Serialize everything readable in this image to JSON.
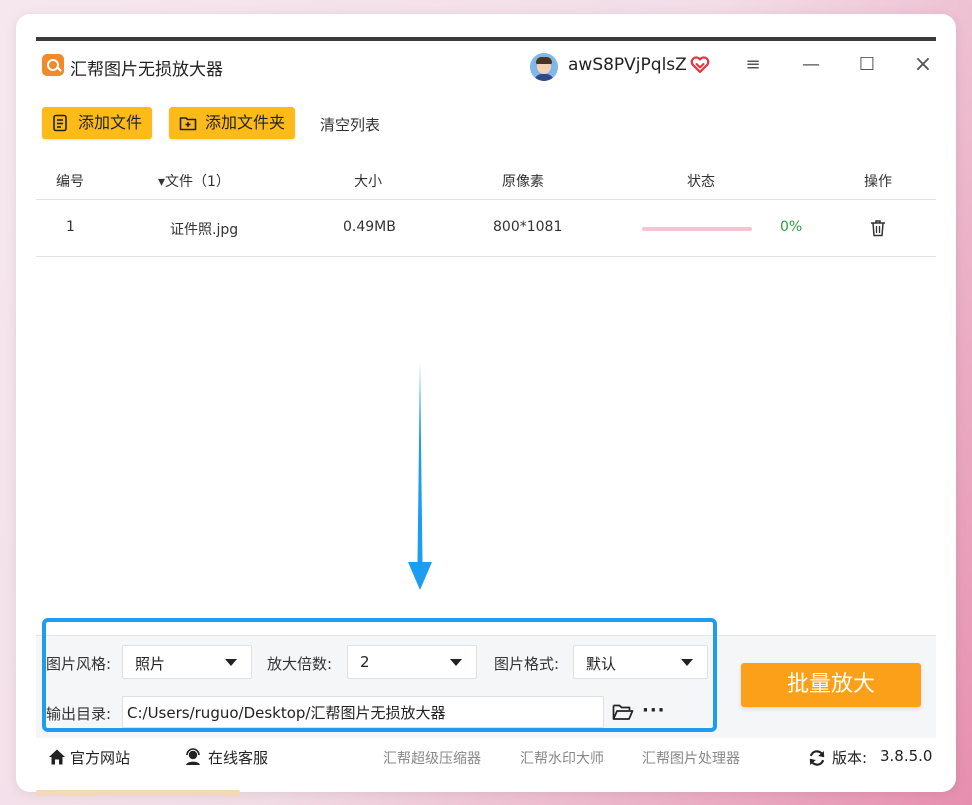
{
  "window": {
    "title": "汇帮图片无损放大器",
    "username": "awS8PVjPqlsZ",
    "controls": {
      "menu": "≡",
      "minimize": "—",
      "maximize": "☐",
      "close": "×"
    }
  },
  "toolbar": {
    "add_file": "添加文件",
    "add_folder": "添加文件夹",
    "clear_list": "清空列表"
  },
  "table": {
    "headers": {
      "index": "编号",
      "file": "▾文件（1）",
      "size": "大小",
      "pixels": "原像素",
      "status": "状态",
      "action": "操作"
    },
    "rows": [
      {
        "index": "1",
        "file": "证件照.jpg",
        "size": "0.49MB",
        "pixels": "800*1081",
        "progress": 0,
        "progress_text": "0%"
      }
    ]
  },
  "settings": {
    "style_label": "图片风格:",
    "style_value": "照片",
    "scale_label": "放大倍数:",
    "scale_value": "2",
    "format_label": "图片格式:",
    "format_value": "默认",
    "output_label": "输出目录:",
    "output_path": "C:/Users/ruguo/Desktop/汇帮图片无损放大器",
    "more": "···",
    "batch_button": "批量放大"
  },
  "footer": {
    "website": "官方网站",
    "support": "在线客服",
    "link1": "汇帮超级压缩器",
    "link2": "汇帮水印大师",
    "link3": "汇帮图片处理器",
    "version_label": "版本:",
    "version": "3.8.5.0"
  },
  "colors": {
    "accent_yellow": "#fdbb19",
    "batch_orange": "#fca01a",
    "highlight_blue": "#1e9df0",
    "progress_pink": "#f5c4d2",
    "status_green": "#2e9e3e"
  },
  "icons": [
    "app-logo-icon",
    "avatar-icon",
    "vip-heart-icon",
    "file-add-icon",
    "folder-add-icon",
    "trash-icon",
    "folder-open-icon",
    "home-icon",
    "headset-icon",
    "refresh-icon",
    "arrow-down-icon"
  ]
}
